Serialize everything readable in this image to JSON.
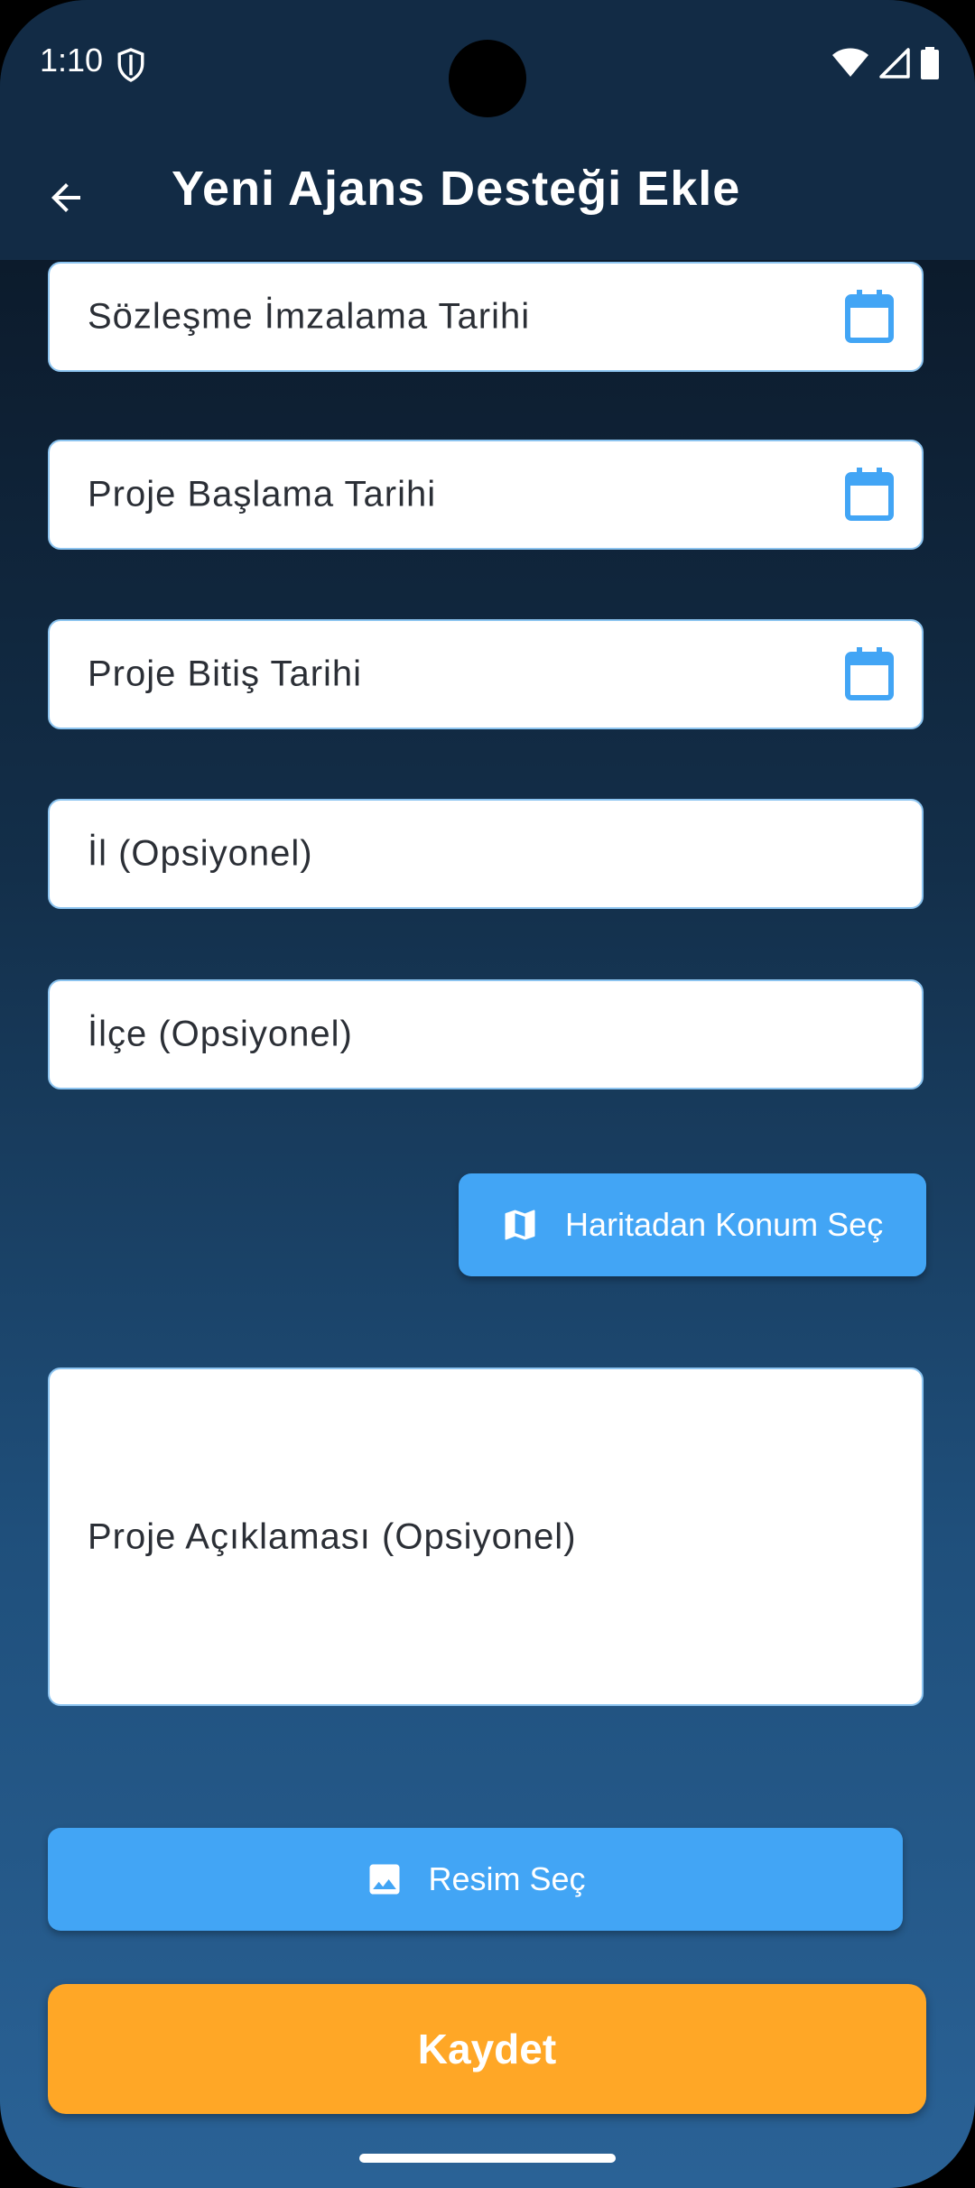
{
  "status_bar": {
    "time": "1:10",
    "icons": [
      "shield-icon",
      "wifi-icon",
      "signal-icon",
      "battery-icon"
    ]
  },
  "app_bar": {
    "title": "Yeni Ajans Desteği Ekle",
    "back_icon": "arrow-back-icon"
  },
  "form": {
    "contract_date_label": "Sözleşme İmzalama Tarihi",
    "project_start_label": "Proje Başlama Tarihi",
    "project_end_label": "Proje Bitiş Tarihi",
    "province_label": "İl (Opsiyonel)",
    "district_label": "İlçe (Opsiyonel)",
    "map_button_label": "Haritadan Konum Seç",
    "description_label": "Proje Açıklaması (Opsiyonel)",
    "image_button_label": "Resim Seç",
    "save_button_label": "Kaydet"
  },
  "colors": {
    "app_bar": "#122b45",
    "field_border": "#8cc4f0",
    "icon_blue": "#42a5f5",
    "primary_button": "#42a5f5",
    "save_button": "#ffa726"
  }
}
